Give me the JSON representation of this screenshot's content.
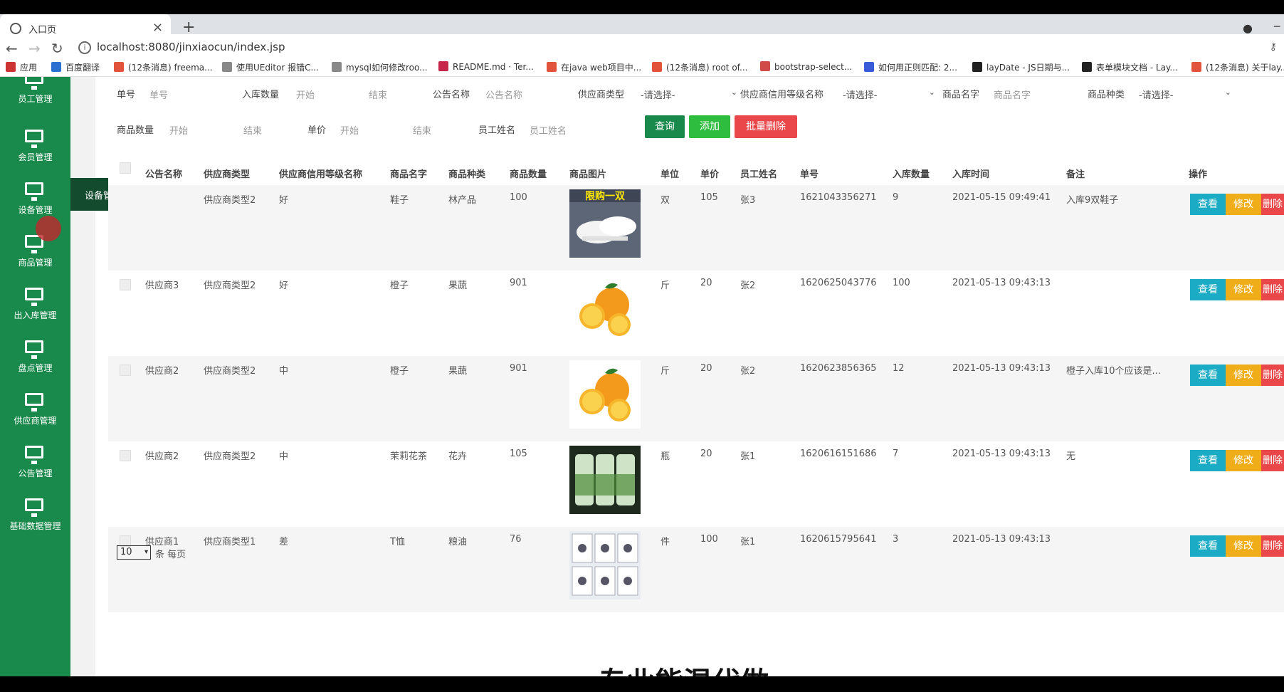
{
  "browser": {
    "tab_title": "入口页",
    "url": "localhost:8080/jinxiaocun/index.jsp",
    "bookmarks": [
      "应用",
      "百度翻译",
      "(12条消息) freema...",
      "使用UEditor 报错C...",
      "mysql如何修改roo...",
      "README.md · Ter...",
      "在java web项目中...",
      "(12条消息) root of...",
      "bootstrap-select...",
      "如何用正则匹配: 2...",
      "layDate - JS日期与...",
      "表单模块文档 - Lay...",
      "(12条消息) 关于lay..."
    ]
  },
  "sidebar": {
    "items": [
      "员工管理",
      "会员管理",
      "设备管理",
      "商品管理",
      "出入库管理",
      "盘点管理",
      "供应商管理",
      "公告管理",
      "基础数据管理"
    ],
    "flyout": "设备管理"
  },
  "filters": {
    "labels": {
      "danhao": "单号",
      "rukushuliang": "入库数量",
      "gonggao": "公告名称",
      "gongyingshang_type": "供应商类型",
      "xinyong": "供应商信用等级名称",
      "shangpin_name": "商品名字",
      "shangpin_zhonglei": "商品种类",
      "shangpin_shuliang": "商品数量",
      "danjia": "单价",
      "yuangong": "员工姓名"
    },
    "placeholders": {
      "danhao": "单号",
      "start": "开始",
      "end": "结束",
      "gonggao": "公告名称",
      "shangpin_name": "商品名字",
      "yuangong": "员工姓名"
    },
    "select_placeholder": "-请选择-",
    "buttons": {
      "query": "查询",
      "add": "添加",
      "batch_delete": "批量删除"
    }
  },
  "table": {
    "headers": [
      "公告名称",
      "供应商类型",
      "供应商信用等级名称",
      "商品名字",
      "商品种类",
      "商品数量",
      "商品图片",
      "单位",
      "单价",
      "员工姓名",
      "单号",
      "入库数量",
      "入库时间",
      "备注",
      "操作"
    ],
    "rows": [
      {
        "gonggao": "",
        "type": "供应商类型2",
        "credit": "好",
        "name": "鞋子",
        "kind": "林产品",
        "qty": "100",
        "img": "shoes",
        "unit": "双",
        "price": "105",
        "staff": "张3",
        "no": "1621043356271",
        "inqty": "9",
        "time": "2021-05-15 09:49:41",
        "note": "入库9双鞋子"
      },
      {
        "gonggao": "供应商3",
        "type": "供应商类型2",
        "credit": "好",
        "name": "橙子",
        "kind": "果蔬",
        "qty": "901",
        "img": "orange",
        "unit": "斤",
        "price": "20",
        "staff": "张2",
        "no": "1620625043776",
        "inqty": "100",
        "time": "2021-05-13 09:43:13",
        "note": ""
      },
      {
        "gonggao": "供应商2",
        "type": "供应商类型2",
        "credit": "中",
        "name": "橙子",
        "kind": "果蔬",
        "qty": "901",
        "img": "orange",
        "unit": "斤",
        "price": "20",
        "staff": "张2",
        "no": "1620623856365",
        "inqty": "12",
        "time": "2021-05-13 09:43:13",
        "note": "橙子入库10个应该是..."
      },
      {
        "gonggao": "供应商2",
        "type": "供应商类型2",
        "credit": "中",
        "name": "茉莉花茶",
        "kind": "花卉",
        "qty": "105",
        "img": "tea",
        "unit": "瓶",
        "price": "20",
        "staff": "张1",
        "no": "1620616151686",
        "inqty": "7",
        "time": "2021-05-13 09:43:13",
        "note": "无"
      },
      {
        "gonggao": "供应商1",
        "type": "供应商类型1",
        "credit": "差",
        "name": "T恤",
        "kind": "粮油",
        "qty": "76",
        "img": "tshirt",
        "unit": "件",
        "price": "100",
        "staff": "张1",
        "no": "1620615795641",
        "inqty": "3",
        "time": "2021-05-13 09:43:13",
        "note": ""
      }
    ],
    "actions": {
      "view": "查看",
      "edit": "修改",
      "del": "删除"
    },
    "shoe_banner": "限购一双"
  },
  "pager": {
    "page_size": "10",
    "suffix": "条 每页"
  },
  "overlay_text": "专业能混代做",
  "colors": {
    "sidebar": "#1a8a4c",
    "query": "#1a8a4c",
    "add": "#2ebd3f",
    "danger": "#e9474a",
    "view": "#1cabc4",
    "edit": "#f0ad1a"
  }
}
